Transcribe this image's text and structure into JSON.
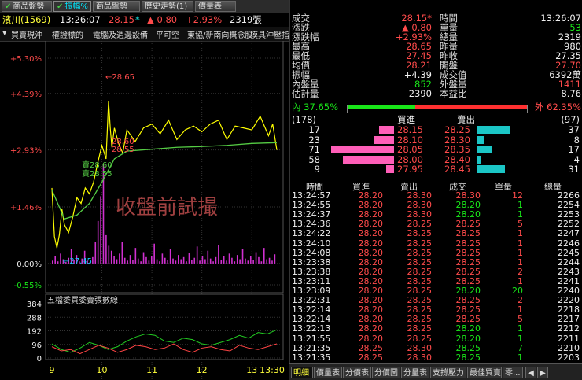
{
  "tabs": [
    {
      "label": "商品盤勢",
      "checked": true,
      "active": false
    },
    {
      "label": "振幅%",
      "checked": true,
      "active": true
    },
    {
      "label": "商品盤勢(1)",
      "checked": false,
      "active": false
    },
    {
      "label": "歷史走勢(1)",
      "checked": false,
      "active": false
    },
    {
      "label": "價量表(1)",
      "checked": false,
      "active": false
    }
  ],
  "info": {
    "name": "濱川(1569)",
    "time": "13:26:07",
    "price": "28.15",
    "star": "*",
    "change": "▲ 0.80",
    "pct": "+2.93%",
    "volume": "2319張"
  },
  "chart_toolbar": {
    "dropdown_icon": "chevron-down-icon",
    "items": [
      "買賣現沖",
      "權證標的",
      "電腦及週邊設備",
      "平可空",
      "東協/新南向概念股",
      "模具沖壓指..."
    ]
  },
  "chart_data": [
    {
      "type": "line",
      "title": "",
      "y_ticks": [
        "+5.30%",
        "+4.39%",
        "+2.93%",
        "+1.46%",
        "0.00%",
        "-0.55%"
      ],
      "x_ticks": [
        "9",
        "10",
        "11",
        "12",
        "13",
        "13:30"
      ],
      "ylim_pct": [
        -0.55,
        5.3
      ],
      "annotations": [
        "←28.65",
        "28.60",
        "28.55",
        "賣28.60",
        "賣28.55",
        "←27.45"
      ],
      "watermark": "收盤前試撮",
      "series": [
        {
          "name": "",
          "color": "#ffff00",
          "x": [
            "9:00",
            "9:03",
            "9:06",
            "9:09",
            "9:12",
            "9:15",
            "9:20",
            "9:25",
            "9:30",
            "9:35",
            "9:40",
            "9:45",
            "9:50",
            "9:55",
            "10:00",
            "10:05",
            "10:08",
            "10:10",
            "10:12",
            "10:15",
            "10:20",
            "10:25",
            "10:30",
            "10:40",
            "10:50",
            "11:00",
            "11:10",
            "11:20",
            "11:30",
            "11:40",
            "11:50",
            "12:00",
            "12:10",
            "12:20",
            "12:30",
            "12:40",
            "12:50",
            "13:00",
            "13:10",
            "13:20",
            "13:25",
            "13:30"
          ],
          "pct": [
            1.95,
            0.7,
            0.4,
            0.75,
            1.4,
            1.0,
            0.8,
            1.2,
            1.7,
            1.55,
            1.95,
            1.8,
            2.1,
            2.6,
            3.05,
            2.7,
            4.2,
            3.5,
            3.0,
            3.5,
            3.1,
            2.85,
            3.45,
            3.15,
            3.5,
            3.6,
            3.35,
            3.7,
            3.2,
            3.45,
            3.55,
            3.4,
            3.6,
            3.7,
            3.2,
            3.55,
            3.5,
            3.45,
            3.8,
            3.3,
            3.6,
            2.93
          ]
        },
        {
          "name": "",
          "color": "#55cc44",
          "x": [
            "9:00",
            "9:15",
            "9:30",
            "9:45",
            "10:00",
            "10:15",
            "10:30",
            "11:00",
            "11:30",
            "12:00",
            "12:30",
            "13:00",
            "13:30"
          ],
          "pct": [
            1.9,
            1.15,
            1.25,
            1.55,
            2.1,
            2.7,
            2.9,
            2.95,
            3.0,
            3.02,
            3.05,
            3.1,
            3.12
          ]
        }
      ]
    },
    {
      "type": "line",
      "title": "五檔委買委賣張數線",
      "y_ticks": [
        "384",
        "288",
        "192",
        "96",
        "0"
      ],
      "x_ticks": [
        "9",
        "10",
        "11",
        "12",
        "13",
        "13:30"
      ],
      "ylim": [
        0,
        384
      ],
      "series": [
        {
          "name": "",
          "color": "#22cc22",
          "values": [
            100,
            60,
            40,
            70,
            110,
            90,
            60,
            80,
            120,
            150,
            170,
            160,
            120,
            110,
            140,
            130,
            100,
            90,
            110,
            130,
            160,
            140,
            180,
            170,
            200
          ]
        },
        {
          "name": "",
          "color": "#ff4444",
          "values": [
            80,
            50,
            60,
            30,
            60,
            90,
            70,
            40,
            60,
            90,
            80,
            60,
            70,
            100,
            60,
            40,
            70,
            80,
            60,
            50,
            90,
            70,
            60,
            80,
            100
          ]
        }
      ]
    }
  ],
  "quote": {
    "rows": [
      {
        "l1": "成交",
        "v1": "28.15*",
        "c1": "r",
        "l2": "時間",
        "v2": "13:26:07",
        "c2": "w"
      },
      {
        "l1": "漲跌",
        "v1": "▲ 0.80",
        "c1": "r",
        "l2": "單量",
        "v2": "53",
        "c2": "g"
      },
      {
        "l1": "漲跌幅",
        "v1": "+2.93%",
        "c1": "r",
        "l2": "總量",
        "v2": "2319",
        "c2": "w"
      },
      {
        "l1": "最高",
        "v1": "28.65",
        "c1": "r",
        "l2": "昨量",
        "v2": "980",
        "c2": "w"
      },
      {
        "l1": "最低",
        "v1": "27.45",
        "c1": "r",
        "l2": "昨收",
        "v2": "27.35",
        "c2": "w"
      },
      {
        "l1": "均價",
        "v1": "28.21",
        "c1": "r",
        "l2": "開盤",
        "v2": "27.70",
        "c2": "r"
      },
      {
        "l1": "振幅",
        "v1": "+4.39",
        "c1": "w",
        "l2": "成交值",
        "v2": "6392萬",
        "c2": "w"
      },
      {
        "l1": "內盤量",
        "v1": "852",
        "c1": "g",
        "l2": "外盤量",
        "v2": "1411",
        "c2": "r"
      },
      {
        "l1": "估計量",
        "v1": "2390",
        "c1": "w",
        "l2": "本益比",
        "v2": "8.76",
        "c2": "w"
      }
    ],
    "inner_label": "內 37.65%",
    "outer_label": "外 62.35%",
    "inner_ratio": 0.3765
  },
  "depth": {
    "bid_total": "(178)",
    "ask_total": "(97)",
    "bid_header": "買進",
    "ask_header": "賣出",
    "rows": [
      {
        "bid_vol": "17",
        "bid": "28.15",
        "ask": "28.25",
        "ask_vol": "37"
      },
      {
        "bid_vol": "23",
        "bid": "28.10",
        "ask": "28.30",
        "ask_vol": "8"
      },
      {
        "bid_vol": "71",
        "bid": "28.05",
        "ask": "28.35",
        "ask_vol": "17"
      },
      {
        "bid_vol": "58",
        "bid": "28.00",
        "ask": "28.40",
        "ask_vol": "4"
      },
      {
        "bid_vol": "9",
        "bid": "27.95",
        "ask": "28.45",
        "ask_vol": "31"
      }
    ]
  },
  "ticks": {
    "headers": [
      "時間",
      "買進",
      "賣出",
      "成交",
      "單量",
      "總量"
    ],
    "rows": [
      [
        "13:24:57",
        "28.20",
        "28.30",
        "28.30",
        "12",
        "2266",
        "r"
      ],
      [
        "13:24:55",
        "28.20",
        "28.30",
        "28.20",
        "1",
        "2254",
        "g"
      ],
      [
        "13:24:37",
        "28.20",
        "28.30",
        "28.20",
        "1",
        "2253",
        "g"
      ],
      [
        "13:24:36",
        "28.20",
        "28.25",
        "28.25",
        "5",
        "2252",
        "r"
      ],
      [
        "13:24:22",
        "28.20",
        "28.25",
        "28.25",
        "1",
        "2247",
        "r"
      ],
      [
        "13:24:10",
        "28.20",
        "28.25",
        "28.25",
        "1",
        "2246",
        "r"
      ],
      [
        "13:24:08",
        "28.20",
        "28.25",
        "28.25",
        "1",
        "2245",
        "r"
      ],
      [
        "13:23:38",
        "28.20",
        "28.25",
        "28.25",
        "1",
        "2244",
        "r"
      ],
      [
        "13:23:38",
        "28.20",
        "28.25",
        "28.25",
        "2",
        "2243",
        "r"
      ],
      [
        "13:23:11",
        "28.20",
        "28.25",
        "28.25",
        "1",
        "2241",
        "r"
      ],
      [
        "13:23:09",
        "28.20",
        "28.25",
        "28.20",
        "20",
        "2240",
        "g"
      ],
      [
        "13:22:31",
        "28.20",
        "28.25",
        "28.25",
        "2",
        "2220",
        "r"
      ],
      [
        "13:22:14",
        "28.20",
        "28.25",
        "28.25",
        "1",
        "2218",
        "r"
      ],
      [
        "13:22:14",
        "28.20",
        "28.25",
        "28.25",
        "5",
        "2217",
        "r"
      ],
      [
        "13:22:13",
        "28.20",
        "28.25",
        "28.20",
        "1",
        "2212",
        "g"
      ],
      [
        "13:21:55",
        "28.20",
        "28.25",
        "28.20",
        "1",
        "2211",
        "g"
      ],
      [
        "13:21:35",
        "28.25",
        "28.30",
        "28.25",
        "7",
        "2210",
        "g"
      ],
      [
        "13:21:35",
        "28.25",
        "28.30",
        "28.25",
        "1",
        "2203",
        "g"
      ]
    ]
  },
  "bottom_tabs": [
    "明細",
    "價量表",
    "分價表",
    "分價圖",
    "分量表",
    "支撐壓力",
    "最佳買賣",
    "零..."
  ],
  "scroll_icons": {
    "left": "arrow-left-icon",
    "right": "arrow-right-icon"
  }
}
